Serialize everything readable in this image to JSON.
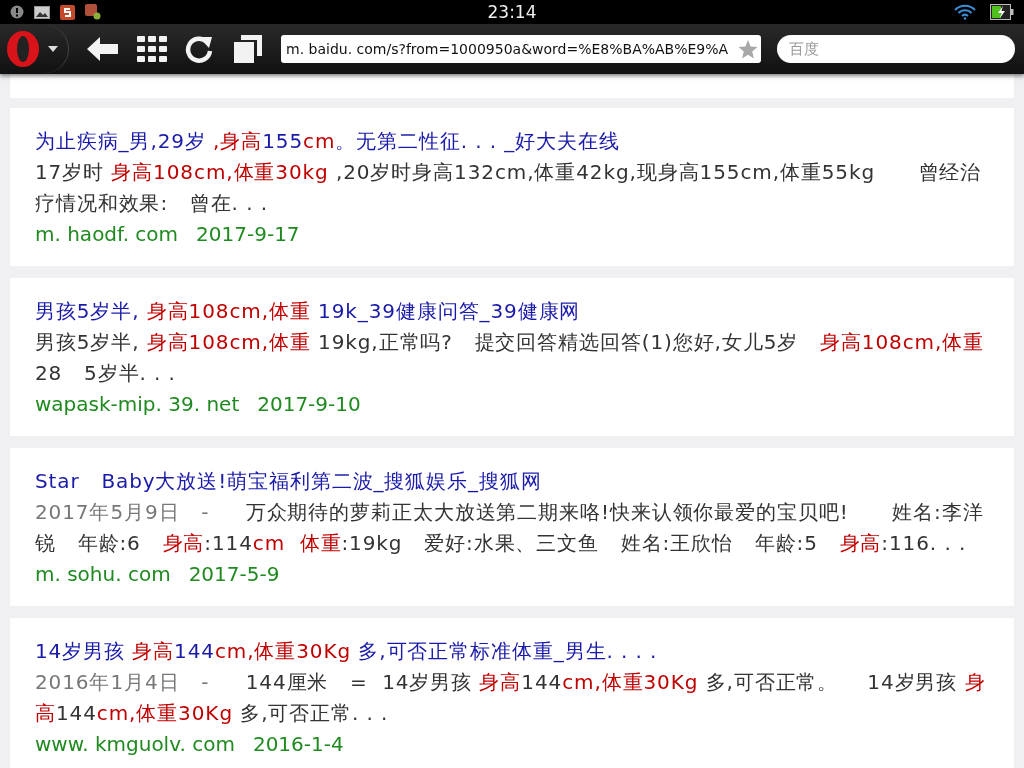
{
  "status_bar": {
    "time": "23:14"
  },
  "toolbar": {
    "url": "m. baidu. com/s?from=1000950a&word=%E8%BA%AB%E9%A",
    "search": {
      "placeholder": "百度"
    }
  },
  "results": [
    {
      "title": [
        {
          "text": "为止疾病_男,29岁 ",
          "highlight": false
        },
        {
          "text": ",身高",
          "highlight": true
        },
        {
          "text": "155",
          "highlight": false
        },
        {
          "text": "cm",
          "highlight": true
        },
        {
          "text": "。无第二性征. . . _好大夫在线",
          "highlight": false
        }
      ],
      "snippet": [
        {
          "text": "17岁时 ",
          "highlight": false
        },
        {
          "text": "身高108cm,体重30kg",
          "highlight": true
        },
        {
          "text": " ,20岁时身高132cm,体重42kg,现身高155cm,体重55kg      曾经治疗情况和效果:   曾在. . .",
          "highlight": false
        }
      ],
      "source": "m. haodf. com",
      "date": "2017-9-17"
    },
    {
      "title": [
        {
          "text": "男孩5岁半, ",
          "highlight": false
        },
        {
          "text": "身高108cm,体重",
          "highlight": true
        },
        {
          "text": " 19k_39健康问答_39健康网",
          "highlight": false
        }
      ],
      "snippet": [
        {
          "text": "男孩5岁半, ",
          "highlight": false
        },
        {
          "text": "身高108cm,体重",
          "highlight": true
        },
        {
          "text": " 19kg,正常吗?   提交回答精选回答(1)您好,女儿5岁   ",
          "highlight": false
        },
        {
          "text": "身高108cm,体重",
          "highlight": true
        },
        {
          "text": "28   5岁半. . .",
          "highlight": false
        }
      ],
      "source": "wapask-mip. 39. net",
      "date": "2017-9-10"
    },
    {
      "title": [
        {
          "text": "Star   Baby大放送!萌宝福利第二波_搜狐娱乐_搜狐网",
          "highlight": false
        }
      ],
      "posted": "2017年5月9日   -",
      "snippet": [
        {
          "text": "     万众期待的萝莉正太大放送第二期来咯!快来认领你最爱的宝贝吧!      姓名:李洋锐   年龄:6   ",
          "highlight": false
        },
        {
          "text": "身高",
          "highlight": true
        },
        {
          "text": ":114",
          "highlight": false
        },
        {
          "text": "cm",
          "highlight": true
        },
        {
          "text": "  体重",
          "highlight": true
        },
        {
          "text": ":19kg   爱好:水果、三文鱼   姓名:王欣怡   年龄:5   ",
          "highlight": false
        },
        {
          "text": "身高",
          "highlight": true
        },
        {
          "text": ":116. . .",
          "highlight": false
        }
      ],
      "source": "m. sohu. com",
      "date": "2017-5-9"
    },
    {
      "title": [
        {
          "text": "14岁男孩 ",
          "highlight": false
        },
        {
          "text": "身高",
          "highlight": true
        },
        {
          "text": "144",
          "highlight": false
        },
        {
          "text": "cm,体重30Kg",
          "highlight": true
        },
        {
          "text": " 多,可否正常标准体重_男生. . . .",
          "highlight": false
        }
      ],
      "posted": "2016年1月4日   -",
      "snippet": [
        {
          "text": "     144厘米   =  14岁男孩 ",
          "highlight": false
        },
        {
          "text": "身高",
          "highlight": true
        },
        {
          "text": "144",
          "highlight": false
        },
        {
          "text": "cm,体重30Kg",
          "highlight": true
        },
        {
          "text": " 多,可否正常。    14岁男孩 ",
          "highlight": false
        },
        {
          "text": "身高",
          "highlight": true
        },
        {
          "text": "144",
          "highlight": false
        },
        {
          "text": "cm,体重30Kg",
          "highlight": true
        },
        {
          "text": " 多,可否正常. . .",
          "highlight": false
        }
      ],
      "source": "www. kmguolv. com",
      "date": "2016-1-4"
    }
  ]
}
